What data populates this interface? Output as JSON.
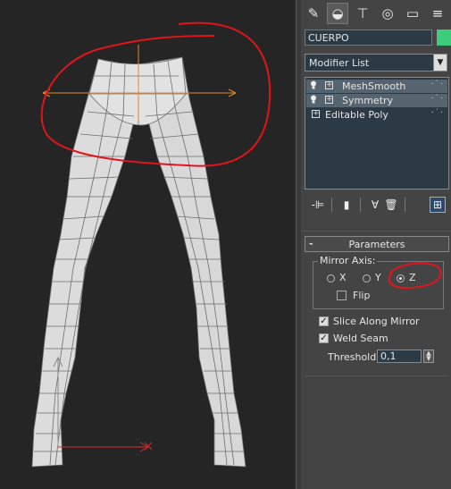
{
  "command_panel": {
    "tabs": [
      {
        "icon": "create-icon"
      },
      {
        "icon": "modify-icon"
      },
      {
        "icon": "hierarchy-icon"
      },
      {
        "icon": "motion-icon"
      },
      {
        "icon": "display-icon"
      },
      {
        "icon": "utilities-icon"
      }
    ],
    "object_name": "CUERPO",
    "object_color": "#3ccc7a",
    "modifier_list_label": "Modifier List",
    "stack": [
      {
        "label": "MeshSmooth",
        "has_bulb": true,
        "selected": true
      },
      {
        "label": "Symmetry",
        "has_bulb": true,
        "selected": true
      },
      {
        "label": "Editable Poly",
        "has_bulb": false,
        "selected": false
      }
    ]
  },
  "parameters": {
    "rollout_title": "Parameters",
    "mirror_axis_label": "Mirror Axis:",
    "axes": [
      {
        "label": "X",
        "selected": false
      },
      {
        "label": "Y",
        "selected": false
      },
      {
        "label": "Z",
        "selected": true
      }
    ],
    "flip_label": "Flip",
    "flip_checked": false,
    "slice_label": "Slice Along Mirror",
    "slice_checked": true,
    "weld_label": "Weld Seam",
    "weld_checked": true,
    "threshold_label": "Threshold:",
    "threshold_value": "0,1"
  },
  "annotation_color": "#e0141a",
  "gizmo_color": "#e08a2a"
}
